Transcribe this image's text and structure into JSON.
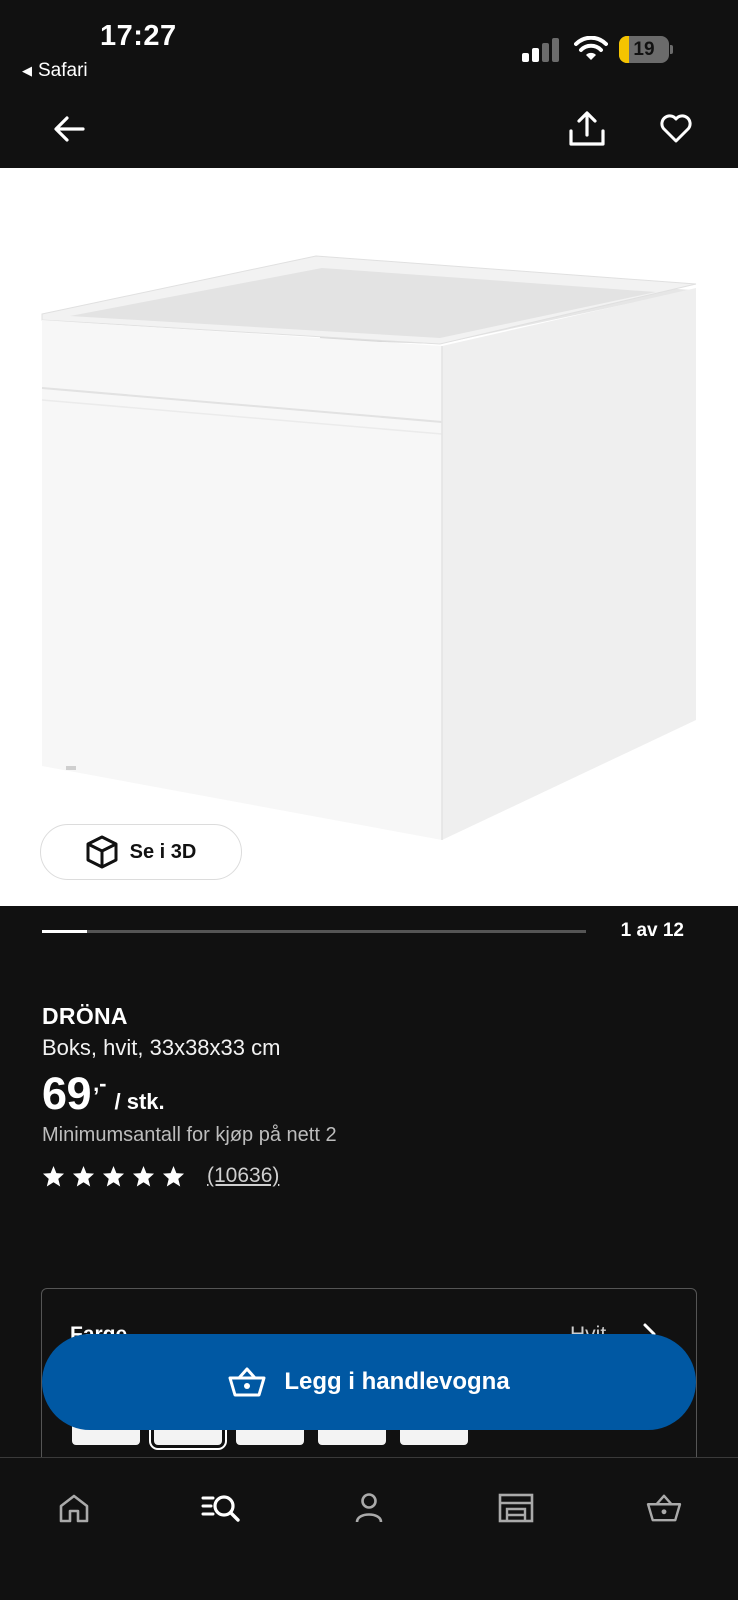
{
  "status_bar": {
    "time": "17:27",
    "back_app": "Safari",
    "battery_level": "19"
  },
  "header": {
    "back_icon": "arrow-left-icon",
    "share_icon": "share-icon",
    "favorite_icon": "heart-icon"
  },
  "gallery": {
    "view_3d_label": "Se i 3D",
    "view_3d_icon": "cube-icon",
    "current_index": 1,
    "total": 12,
    "counter_text": "1 av 12",
    "progress_fraction": 0.083
  },
  "product": {
    "name": "DRÖNA",
    "description": "Boks, hvit, 33x38x33 cm",
    "price_main": "69",
    "price_decimals": ",-",
    "price_unit": "/ stk.",
    "min_quantity": "Minimumsantall for kjøp på nett 2",
    "rating_stars": 5,
    "rating_count": "(10636)"
  },
  "color_selector": {
    "label": "Farge",
    "value": "Hvit",
    "swatch_count": 5,
    "selected_index": 1
  },
  "cart_button": {
    "label": "Legg i handlevogna",
    "icon": "basket-icon",
    "color": "#0058a3"
  },
  "bottom_nav": {
    "items": [
      "home-icon",
      "search-products-icon",
      "profile-icon",
      "store-icon",
      "basket-icon"
    ]
  }
}
